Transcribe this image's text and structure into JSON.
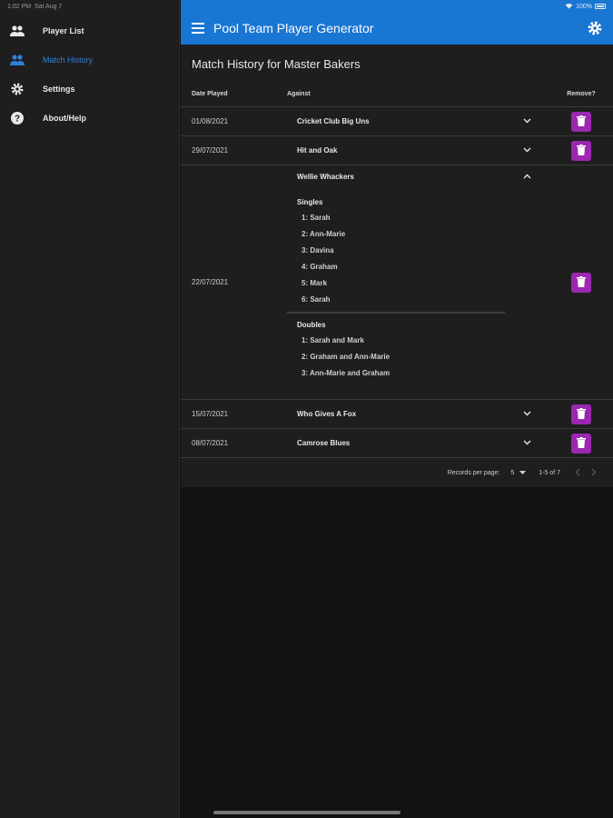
{
  "status": {
    "time": "1:02 PM",
    "date": "Sat Aug 7",
    "battery": "100%"
  },
  "sidebar": {
    "items": [
      {
        "label": "Player List",
        "icon": "people-icon",
        "active": false
      },
      {
        "label": "Match History",
        "icon": "people-icon",
        "active": true
      },
      {
        "label": "Settings",
        "icon": "gear-icon",
        "active": false
      },
      {
        "label": "About/Help",
        "icon": "help-icon",
        "active": false
      }
    ]
  },
  "appbar": {
    "title": "Pool Team Player Generator"
  },
  "card": {
    "title": "Match History for Master Bakers",
    "headers": {
      "date": "Date Played",
      "against": "Against",
      "remove": "Remove?"
    },
    "rows": [
      {
        "date": "01/08/2021",
        "against": "Cricket Club Big Uns"
      },
      {
        "date": "29/07/2021",
        "against": "Hit and Oak"
      },
      {
        "date": "22/07/2021",
        "against": "Wellie Whackers",
        "singles_title": "Singles",
        "singles": [
          "1: Sarah",
          "2: Ann-Marie",
          "3: Davina",
          "4: Graham",
          "5: Mark",
          "6: Sarah"
        ],
        "doubles_title": "Doubles",
        "doubles": [
          "1: Sarah and Mark",
          "2: Graham and Ann-Marie",
          "3: Ann-Marie and Graham"
        ]
      },
      {
        "date": "15/07/2021",
        "against": "Who Gives A Fox"
      },
      {
        "date": "08/07/2021",
        "against": "Camrose Blues"
      }
    ],
    "footer": {
      "rows_per_page_label": "Records per page:",
      "rows_per_page": "5",
      "range": "1-5 of 7"
    }
  },
  "colors": {
    "accent": "#1976d2",
    "trash": "#9c27b0",
    "active_nav": "#2f7fd8"
  }
}
